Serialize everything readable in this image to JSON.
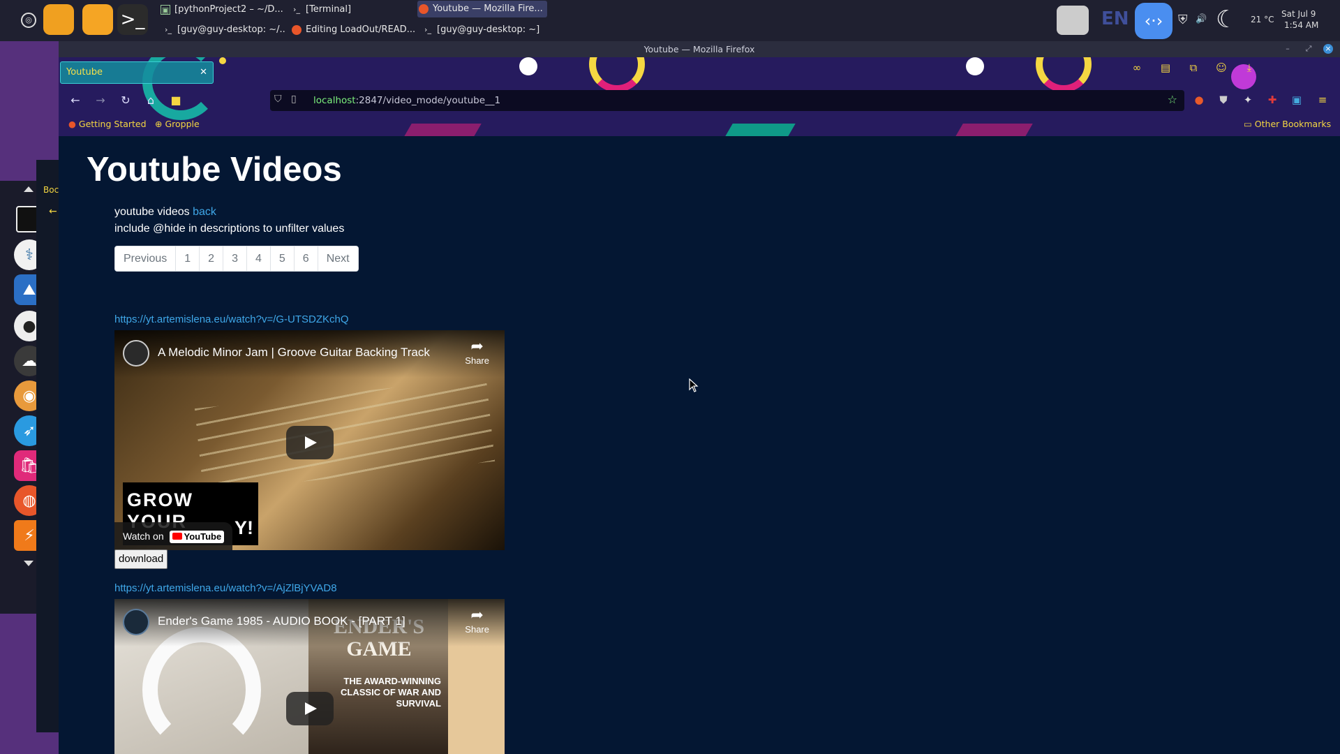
{
  "desktop": {
    "tasks": [
      {
        "label": "[pythonProject2 – ~/D...",
        "icon": "pycharm-icon"
      },
      {
        "label": "[Terminal]",
        "icon": "terminal-icon"
      },
      {
        "label": "Youtube — Mozilla Fire...",
        "icon": "firefox-icon",
        "active": true
      },
      {
        "label": "[guy@guy-desktop: ~/...",
        "icon": "terminal-icon"
      },
      {
        "label": "Editing LoadOut/READ...",
        "icon": "firefox-icon"
      },
      {
        "label": "[guy@guy-desktop: ~]",
        "icon": "terminal-icon"
      }
    ],
    "tray": {
      "lang": "EN",
      "temperature": "21 °C",
      "date": "Sat Jul 9",
      "time": "1:54 AM"
    },
    "side_panel_label": "Boc"
  },
  "window": {
    "title": "Youtube — Mozilla Firefox"
  },
  "browser": {
    "tab_title": "Youtube",
    "url_host": "localhost",
    "url_path": ":2847/video_mode/youtube__1",
    "bookmarks": [
      "Getting Started",
      "Gropple"
    ],
    "other_bookmarks": "Other Bookmarks"
  },
  "page": {
    "title": "Youtube Videos",
    "intro_text": "youtube videos",
    "back_link": "back",
    "hint": "include @hide in descriptions to unfilter values",
    "pagination": {
      "previous": "Previous",
      "pages": [
        "1",
        "2",
        "3",
        "4",
        "5",
        "6"
      ],
      "next": "Next"
    },
    "videos": [
      {
        "url": "https://yt.artemislena.eu/watch?v=/G-UTSDZKchQ",
        "title": "A Melodic Minor Jam | Groove Guitar Backing Track",
        "share": "Share",
        "watch_on": "Watch on",
        "yt_brand": "YouTube",
        "overlay_line1": "GROW YOUR",
        "overlay_line2": "Y!",
        "download": "download"
      },
      {
        "url": "https://yt.artemislena.eu/watch?v=/AjZlBjYVAD8",
        "title": "Ender's Game 1985 - AUDIO BOOK - [PART 1]",
        "share": "Share",
        "cover_title": "ENDER'S GAME",
        "cover_subtitle": "THE AWARD-WINNING CLASSIC OF WAR AND SURVIVAL"
      }
    ]
  }
}
